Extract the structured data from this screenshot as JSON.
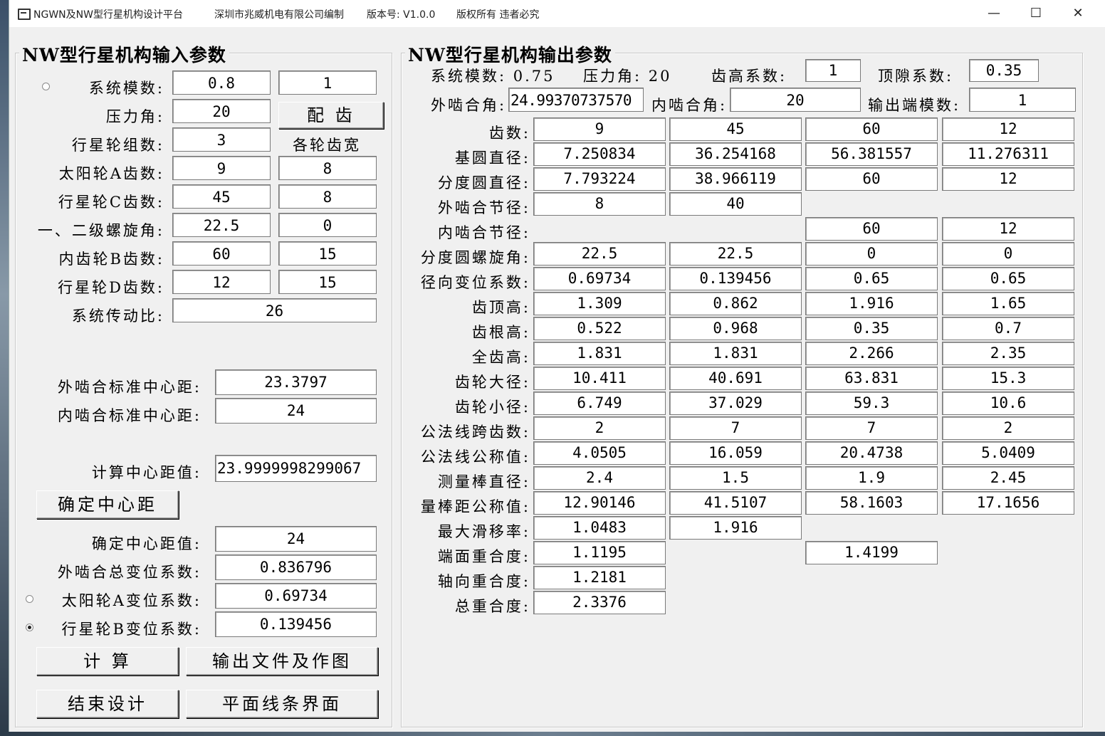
{
  "titlebar": {
    "app_title": "NGWN及NW型行星机构设计平台",
    "company": "深圳市兆威机电有限公司编制",
    "version": "版本号:  V1.0.0",
    "copyright": "版权所有 违者必究",
    "minimize": "—",
    "maximize": "☐",
    "close": "✕"
  },
  "input_panel": {
    "title": "NW型行星机构输入参数",
    "module_label": "系统模数:",
    "module_value": "0.8",
    "module_value2": "1",
    "pressure_angle_label": "压力角:",
    "pressure_angle_value": "20",
    "match_button": "配  齿",
    "planet_groups_label": "行星轮组数:",
    "planet_groups_value": "3",
    "face_width_caption": "各轮齿宽",
    "sun_a_teeth_label": "太阳轮A齿数:",
    "sun_a_teeth_value": "9",
    "sun_a_width": "8",
    "planet_c_teeth_label": "行星轮C齿数:",
    "planet_c_teeth_value": "45",
    "planet_c_width": "8",
    "helix_label": "一、二级螺旋角:",
    "helix_value": "22.5",
    "helix_value2": "0",
    "ring_b_teeth_label": "内齿轮B齿数:",
    "ring_b_teeth_value": "60",
    "ring_b_width": "15",
    "planet_d_teeth_label": "行星轮D齿数:",
    "planet_d_teeth_value": "12",
    "planet_d_width": "15",
    "ratio_label": "系统传动比:",
    "ratio_value": "26",
    "ext_std_center_label": "外啮合标准中心距:",
    "ext_std_center_value": "23.3797",
    "int_std_center_label": "内啮合标准中心距:",
    "int_std_center_value": "24",
    "calc_center_label": "计算中心距值:",
    "calc_center_value": "23.9999998299067",
    "confirm_center_button": "确定中心距",
    "confirmed_center_label": "确定中心距值:",
    "confirmed_center_value": "24",
    "ext_total_shift_label": "外啮合总变位系数:",
    "ext_total_shift_value": "0.836796",
    "sun_a_shift_label": "太阳轮A变位系数:",
    "sun_a_shift_value": "0.69734",
    "planet_b_shift_label": "行星轮B变位系数:",
    "planet_b_shift_value": "0.139456",
    "calculate_button": "计  算",
    "output_file_button": "输出文件及作图",
    "end_design_button": "结束设计",
    "plane_lines_button": "平面线条界面"
  },
  "output_panel": {
    "title": "NW型行星机构输出参数",
    "system_module_text": "系统模数: 0.75",
    "pressure_angle_text": "压力角: 20",
    "addendum_coef_label": "齿高系数:",
    "addendum_coef_value": "1",
    "clearance_coef_label": "顶隙系数:",
    "clearance_coef_value": "0.35",
    "ext_mesh_angle_label": "外啮合角:",
    "ext_mesh_angle_value": "24.99370737570",
    "int_mesh_angle_label": "内啮合角:",
    "int_mesh_angle_value": "20",
    "output_module_label": "输出端模数:",
    "output_module_value": "1",
    "rows": [
      {
        "label": "齿数:",
        "cells": [
          "9",
          "45",
          "60",
          "12"
        ]
      },
      {
        "label": "基圆直径:",
        "cells": [
          "7.250834",
          "36.254168",
          "56.381557",
          "11.276311"
        ]
      },
      {
        "label": "分度圆直径:",
        "cells": [
          "7.793224",
          "38.966119",
          "60",
          "12"
        ]
      },
      {
        "label": "外啮合节径:",
        "cells": [
          "8",
          "40",
          null,
          null
        ]
      },
      {
        "label": "内啮合节径:",
        "cells": [
          null,
          null,
          "60",
          "12"
        ]
      },
      {
        "label": "分度圆螺旋角:",
        "cells": [
          "22.5",
          "22.5",
          "0",
          "0"
        ]
      },
      {
        "label": "径向变位系数:",
        "cells": [
          "0.69734",
          "0.139456",
          "0.65",
          "0.65"
        ]
      },
      {
        "label": "齿顶高:",
        "cells": [
          "1.309",
          "0.862",
          "1.916",
          "1.65"
        ]
      },
      {
        "label": "齿根高:",
        "cells": [
          "0.522",
          "0.968",
          "0.35",
          "0.7"
        ]
      },
      {
        "label": "全齿高:",
        "cells": [
          "1.831",
          "1.831",
          "2.266",
          "2.35"
        ]
      },
      {
        "label": "齿轮大径:",
        "cells": [
          "10.411",
          "40.691",
          "63.831",
          "15.3"
        ]
      },
      {
        "label": "齿轮小径:",
        "cells": [
          "6.749",
          "37.029",
          "59.3",
          "10.6"
        ]
      },
      {
        "label": "公法线跨齿数:",
        "cells": [
          "2",
          "7",
          "7",
          "2"
        ]
      },
      {
        "label": "公法线公称值:",
        "cells": [
          "4.0505",
          "16.059",
          "20.4738",
          "5.0409"
        ]
      },
      {
        "label": "测量棒直径:",
        "cells": [
          "2.4",
          "1.5",
          "1.9",
          "2.45"
        ]
      },
      {
        "label": "量棒距公称值:",
        "cells": [
          "12.90146",
          "41.5107",
          "58.1603",
          "17.1656"
        ]
      },
      {
        "label": "最大滑移率:",
        "cells": [
          "1.0483",
          "1.916",
          null,
          null
        ]
      },
      {
        "label": "端面重合度:",
        "cells": [
          "1.1195",
          null,
          "1.4199",
          null
        ]
      },
      {
        "label": "轴向重合度:",
        "cells": [
          "1.2181",
          null,
          null,
          null
        ]
      },
      {
        "label": "总重合度:",
        "cells": [
          "2.3376",
          null,
          null,
          null
        ]
      }
    ]
  }
}
